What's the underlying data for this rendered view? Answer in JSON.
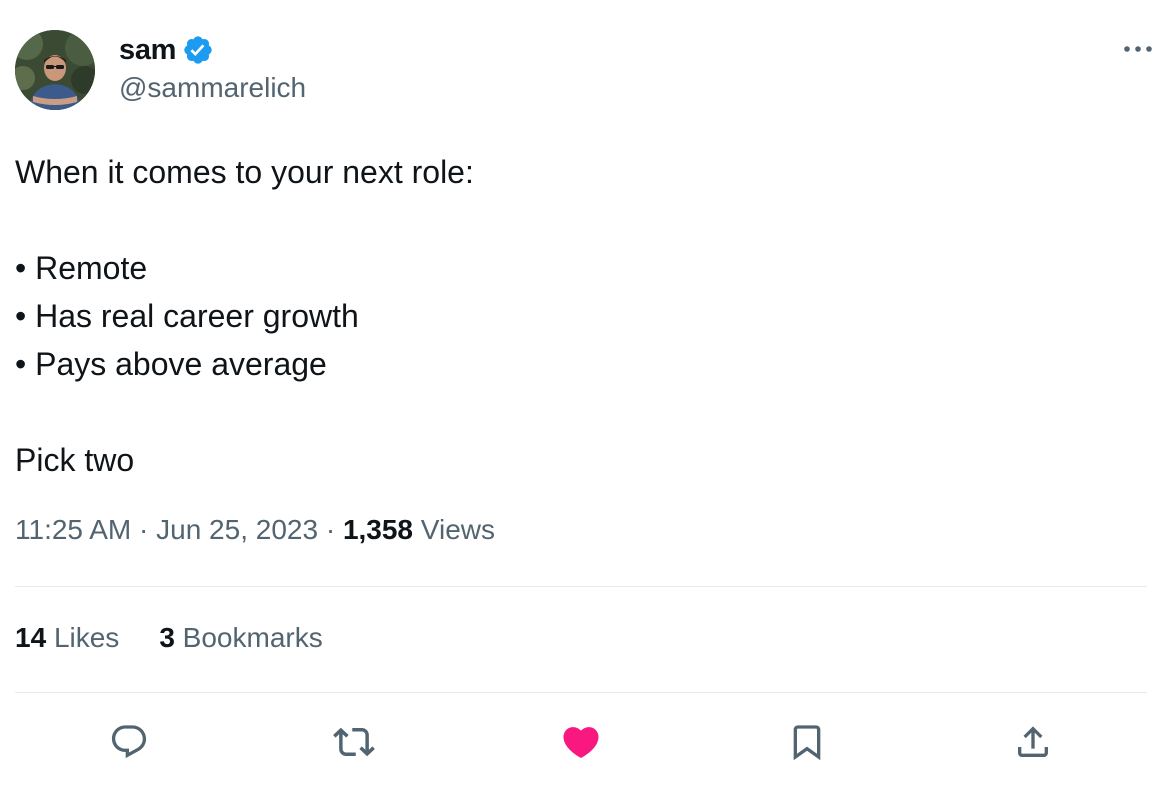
{
  "author": {
    "display_name": "sam",
    "handle": "@sammarelich",
    "verified": true
  },
  "tweet": {
    "lines": [
      "When it comes to your next role:",
      "",
      "• Remote",
      "• Has real career growth",
      "• Pays above average",
      "",
      "Pick two"
    ]
  },
  "meta": {
    "time": "11:25 AM",
    "separator": " · ",
    "date": "Jun 25, 2023",
    "views_count": "1,358",
    "views_label": "Views"
  },
  "stats": {
    "likes_count": "14",
    "likes_label": "Likes",
    "bookmarks_count": "3",
    "bookmarks_label": "Bookmarks"
  },
  "actions": {
    "icons": [
      "reply-icon",
      "retweet-icon",
      "like-icon",
      "bookmark-icon",
      "share-icon"
    ],
    "liked": true
  },
  "colors": {
    "text_primary": "#0f1419",
    "text_secondary": "#536471",
    "verified_blue": "#1d9bf0",
    "like_pink": "#f91880",
    "divider": "#e7e9ea"
  }
}
